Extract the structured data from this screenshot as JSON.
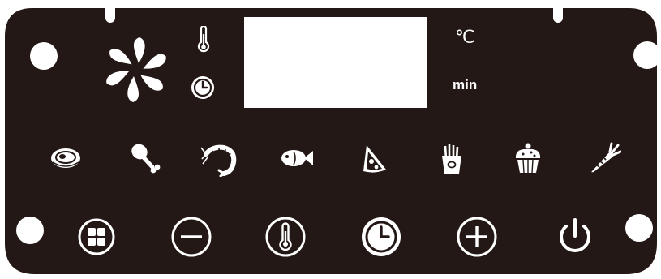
{
  "colors": {
    "panel": "#231815",
    "symbol": "#ffffff",
    "display": "#ffffff"
  },
  "display": {
    "temperature_unit": "℃",
    "time_unit": "min"
  },
  "status_icons": [
    "fan-icon",
    "thermometer-icon",
    "clock-icon"
  ],
  "presets": [
    {
      "icon": "steak-icon"
    },
    {
      "icon": "chicken-leg-icon"
    },
    {
      "icon": "shrimp-icon"
    },
    {
      "icon": "fish-icon"
    },
    {
      "icon": "pizza-icon"
    },
    {
      "icon": "fries-icon"
    },
    {
      "icon": "cupcake-icon"
    },
    {
      "icon": "carrot-icon"
    }
  ],
  "buttons": [
    {
      "icon": "menu-grid-icon"
    },
    {
      "icon": "minus-icon"
    },
    {
      "icon": "thermometer-icon"
    },
    {
      "icon": "clock-icon"
    },
    {
      "icon": "plus-icon"
    },
    {
      "icon": "power-icon"
    }
  ]
}
